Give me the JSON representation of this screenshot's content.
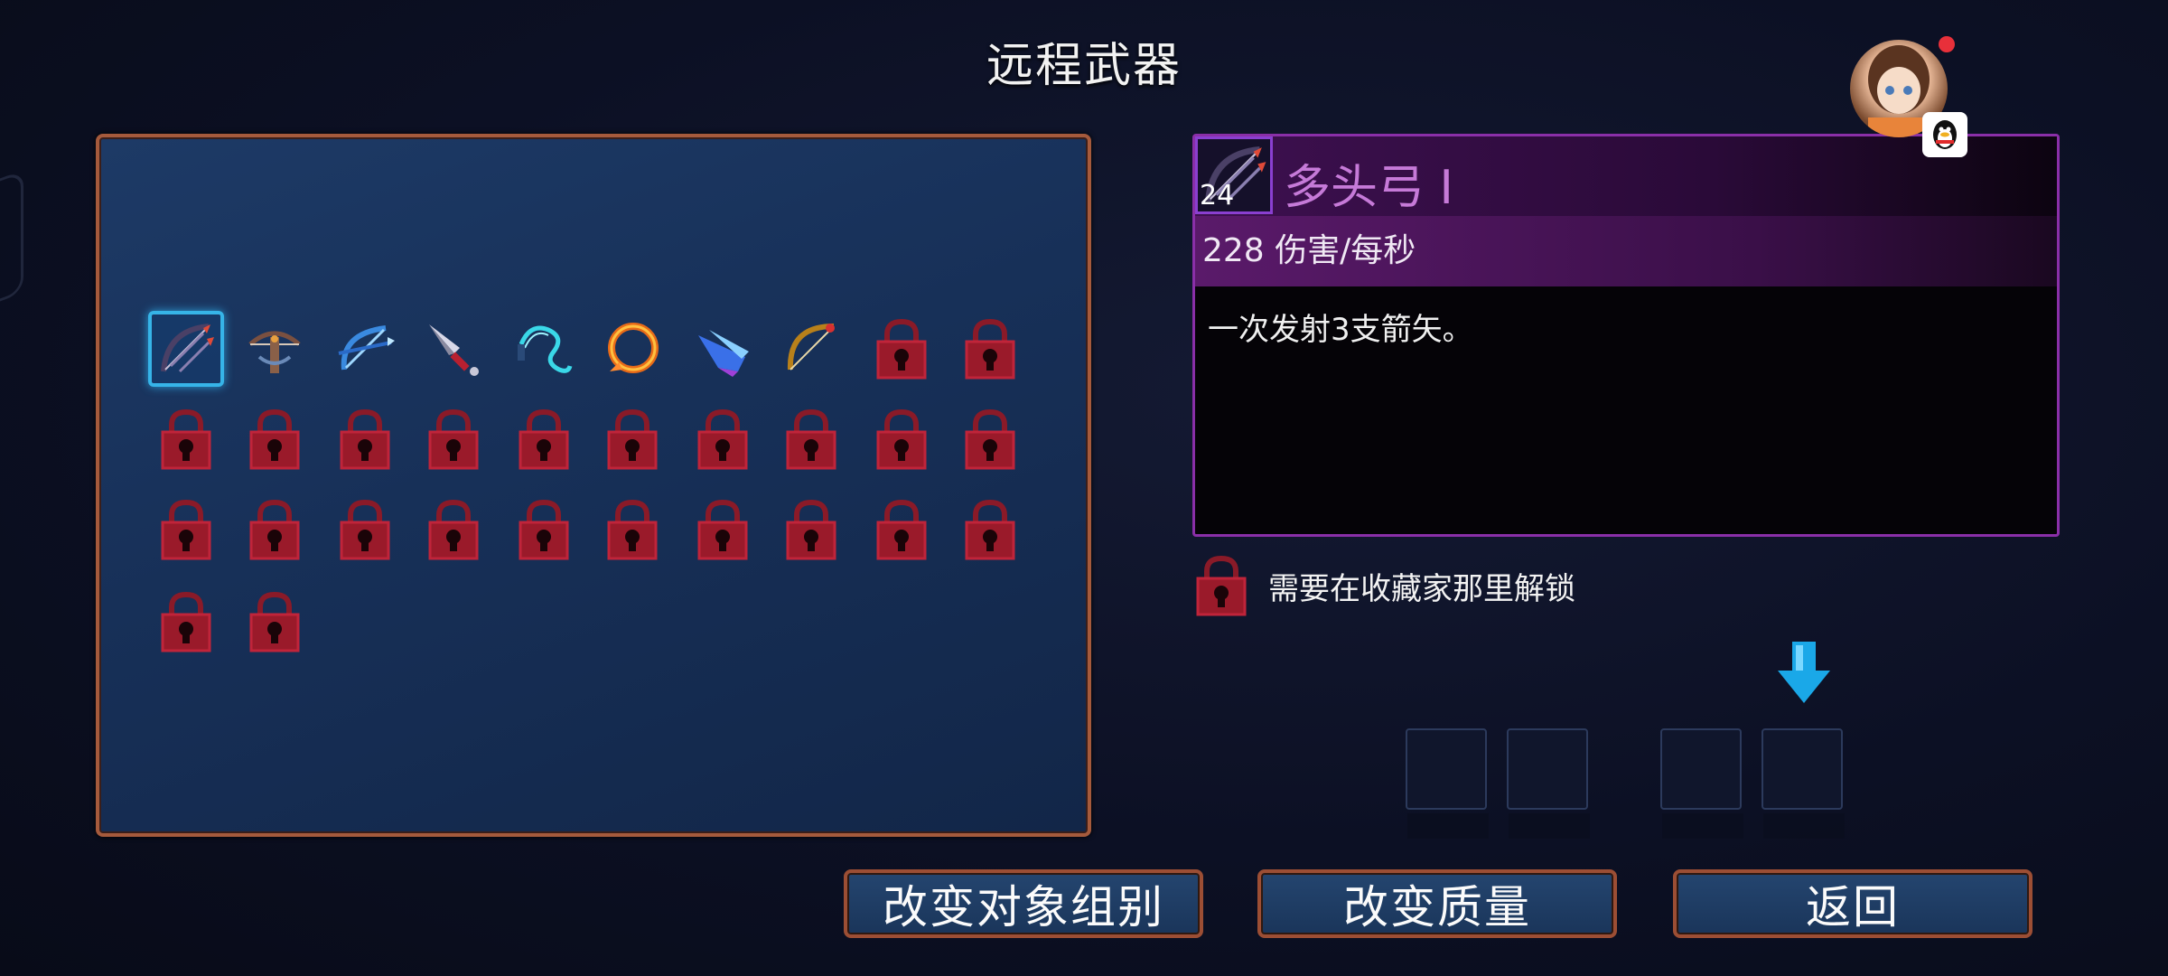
{
  "title": "远程武器",
  "weapons": [
    {
      "icon": "multishot-bow-icon"
    },
    {
      "icon": "repeater-crossbow-icon"
    },
    {
      "icon": "ice-bow-icon"
    },
    {
      "icon": "throwing-knife-icon"
    },
    {
      "icon": "lightning-whip-icon"
    },
    {
      "icon": "fire-ring-icon"
    },
    {
      "icon": "ice-shard-icon"
    },
    {
      "icon": "golden-bow-icon"
    }
  ],
  "locked_count": 24,
  "selected": {
    "level": "24",
    "name": "多头弓 I",
    "dps": "228 伤害/每秒",
    "description": "一次发射3支箭矢。"
  },
  "unlock_hint": "需要在收藏家那里解锁",
  "buttons": {
    "change_group": "改变对象组别",
    "change_quality": "改变质量",
    "back": "返回"
  },
  "colors": {
    "panel_border": "#a55a3c",
    "info_border": "#8a2fa8",
    "selection": "#36b4e8",
    "lock_red": "#c0243a"
  }
}
